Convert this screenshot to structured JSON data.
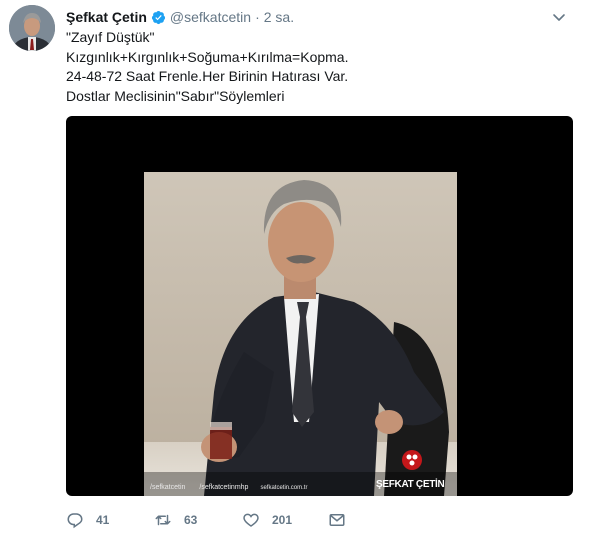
{
  "tweet": {
    "author_name": "Şefkat Çetin",
    "author_handle": "@sefkatcetin",
    "separator": "·",
    "timestamp": "2 sa.",
    "lines": [
      "\"Zayıf Düştük\"",
      "Kızgınlık+Kırgınlık+Soğuma+Kırılma=Kopma.",
      "24-48-72 Saat Frenle.Her Birinin Hatırası Var.",
      "Dostlar Meclisinin\"Sabır\"Söylemleri"
    ],
    "image_overlay": {
      "twitter": "/sefkatcetin",
      "facebook": "/sefkatcetinmhp",
      "website": "sefkatcetin.com.tr",
      "signature": "ŞEFKAT ÇETİN"
    },
    "stats": {
      "replies": "41",
      "retweets": "63",
      "likes": "201"
    }
  },
  "icons": {
    "verified": "verified-badge-icon",
    "caret": "chevron-down-icon",
    "reply": "reply-icon",
    "retweet": "retweet-icon",
    "like": "heart-icon",
    "dm": "envelope-icon"
  },
  "colors": {
    "text": "#14171a",
    "secondary": "#657786",
    "verified": "#1da1f2",
    "media_bg": "#000000"
  }
}
